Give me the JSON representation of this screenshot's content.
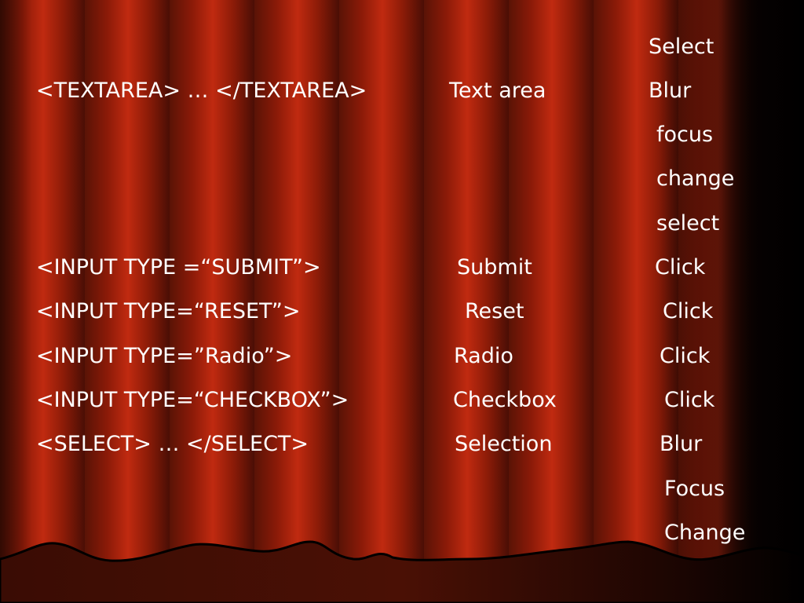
{
  "slide": {
    "rows": [
      {
        "tag": "",
        "desc": "",
        "events": [
          "Select"
        ]
      },
      {
        "tag": "<TEXTAREA> … </TEXTAREA>",
        "desc": "Text area",
        "events": [
          "Blur",
          "focus",
          "change",
          "select"
        ]
      },
      {
        "tag": "<INPUT TYPE =“SUBMIT”>",
        "desc": "Submit",
        "events": [
          "Click"
        ]
      },
      {
        "tag": "<INPUT TYPE=“RESET”>",
        "desc": "Reset",
        "events": [
          "Click"
        ]
      },
      {
        "tag": "<INPUT TYPE=”Radio”>",
        "desc": "Radio",
        "events": [
          "Click"
        ]
      },
      {
        "tag": "<INPUT TYPE=“CHECKBOX”>",
        "desc": "Checkbox",
        "events": [
          "Click"
        ]
      },
      {
        "tag": "<SELECT> … </SELECT>",
        "desc": "Selection",
        "events": [
          "Blur",
          "Focus",
          "Change"
        ]
      }
    ]
  }
}
